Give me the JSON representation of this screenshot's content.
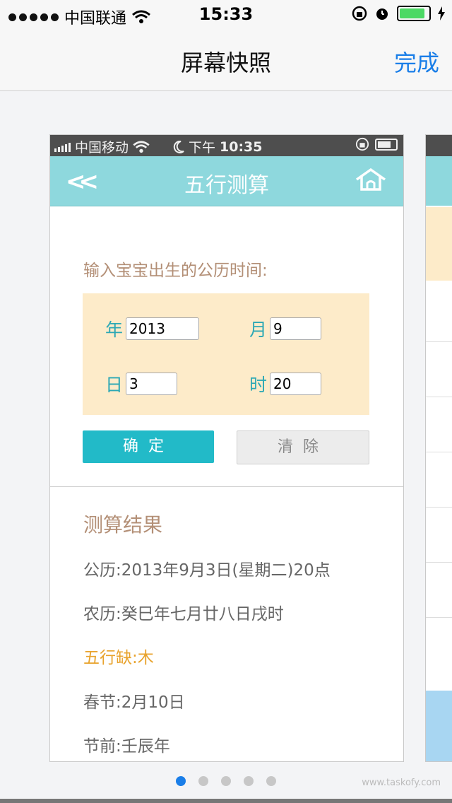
{
  "outer_status": {
    "carrier": "中国联通",
    "time": "15:33"
  },
  "outer_nav": {
    "title": "屏幕快照",
    "done": "完成"
  },
  "inner_status": {
    "carrier": "中国移动",
    "time_prefix": "下午",
    "time": "10:35"
  },
  "inner_header": {
    "title": "五行测算",
    "back": "<<"
  },
  "form": {
    "prompt": "输入宝宝出生的公历时间:",
    "year_label": "年",
    "year_value": "2013",
    "month_label": "月",
    "month_value": "9",
    "day_label": "日",
    "day_value": "3",
    "hour_label": "时",
    "hour_value": "20",
    "confirm": "确定",
    "clear": "清除"
  },
  "result": {
    "title": "测算结果",
    "lines": [
      "公历:2013年9月3日(星期二)20点",
      "农历:癸巳年七月廿八日戌时",
      "五行缺:木",
      "春节:2月10日",
      "节前:壬辰年"
    ]
  },
  "pager": {
    "count": 5,
    "active": 0
  },
  "watermark": "www.taskofy.com",
  "colors": {
    "accent": "#1a7ee8",
    "header": "#8ed8dd",
    "confirm": "#22bac8",
    "highlight": "#e8a32d",
    "input_bg": "#fdebc9"
  }
}
